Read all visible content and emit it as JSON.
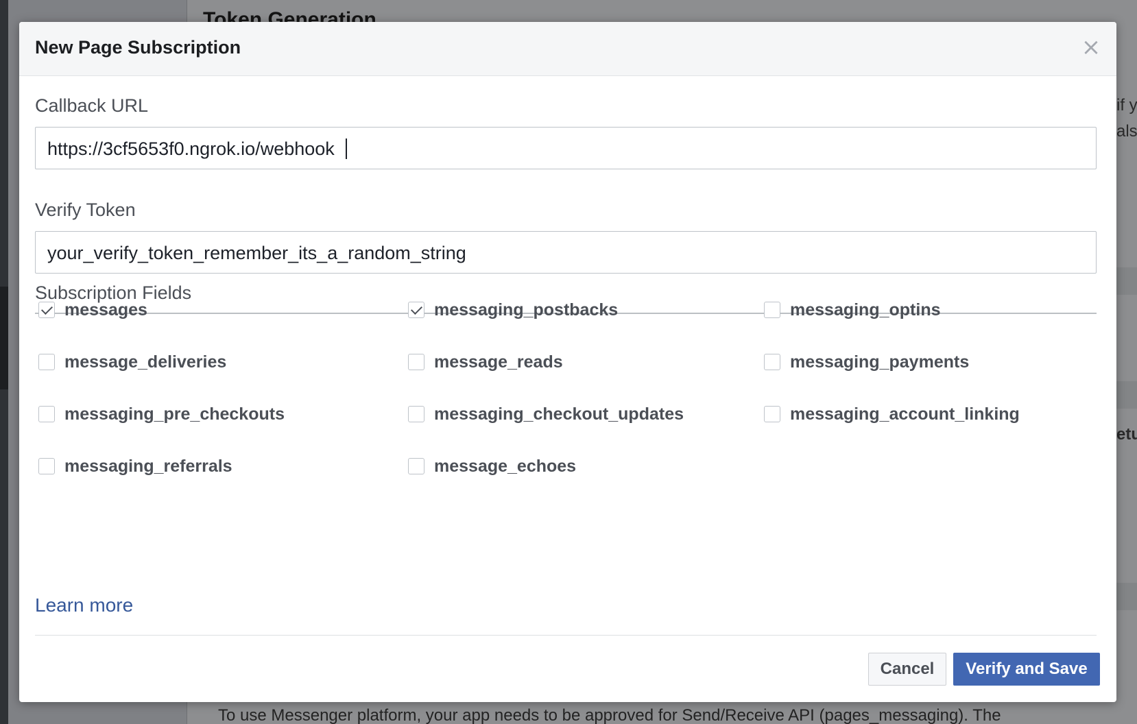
{
  "background": {
    "title_fragment": "Token Generation",
    "right_fragments": [
      "if y",
      "als",
      "etu"
    ],
    "bottom_text": "To use Messenger platform, your app needs to be approved for Send/Receive API (pages_messaging). The"
  },
  "modal": {
    "title": "New Page Subscription",
    "close_label": "×",
    "callback_url": {
      "label": "Callback URL",
      "value": "https://3cf5653f0.ngrok.io/webhook"
    },
    "verify_token": {
      "label": "Verify Token",
      "value": "your_verify_token_remember_its_a_random_string"
    },
    "subscription_fields": {
      "label": "Subscription Fields",
      "items": [
        {
          "name": "messages",
          "checked": true
        },
        {
          "name": "messaging_postbacks",
          "checked": true
        },
        {
          "name": "messaging_optins",
          "checked": false
        },
        {
          "name": "message_deliveries",
          "checked": false
        },
        {
          "name": "message_reads",
          "checked": false
        },
        {
          "name": "messaging_payments",
          "checked": false
        },
        {
          "name": "messaging_pre_checkouts",
          "checked": false
        },
        {
          "name": "messaging_checkout_updates",
          "checked": false
        },
        {
          "name": "messaging_account_linking",
          "checked": false
        },
        {
          "name": "messaging_referrals",
          "checked": false
        },
        {
          "name": "message_echoes",
          "checked": false
        }
      ]
    },
    "learn_more": "Learn more",
    "buttons": {
      "cancel": "Cancel",
      "verify_and_save": "Verify and Save"
    },
    "colors": {
      "primary": "#4267b2",
      "link": "#365899"
    }
  }
}
